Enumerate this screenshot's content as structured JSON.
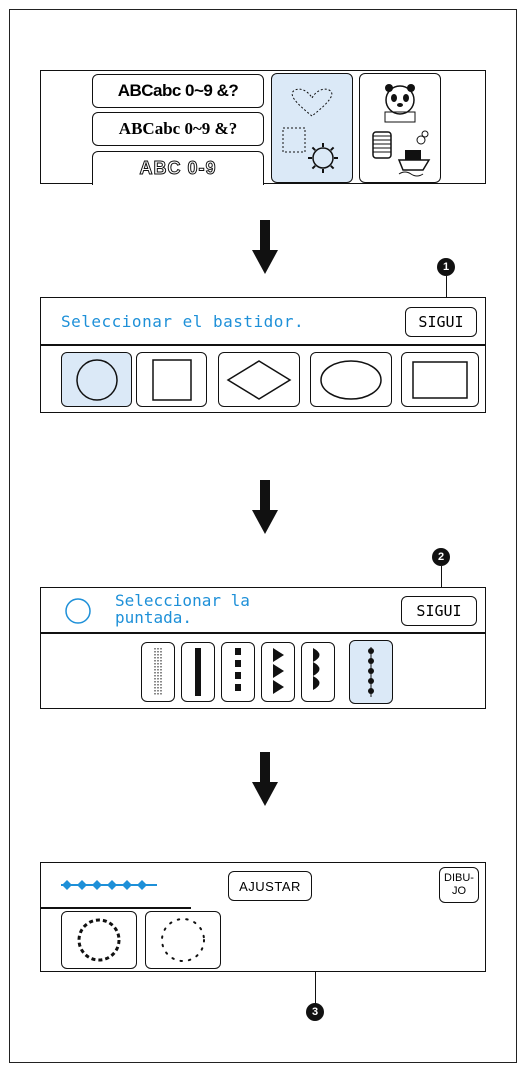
{
  "screen1": {
    "fonts": [
      "ABCabc 0~9 &?",
      "ABCabc 0~9 &?",
      "ABC 0-9"
    ]
  },
  "screen2": {
    "prompt": "Seleccionar el bastidor.",
    "next_button": "SIGUI",
    "frames": [
      "circle",
      "square",
      "diamond",
      "oval",
      "rectangle"
    ],
    "selected_frame": "circle",
    "callout": "1"
  },
  "screen3": {
    "prompt_line1": "Seleccionar la",
    "prompt_line2": "puntada.",
    "next_button": "SIGUI",
    "stitches": [
      "triple-line",
      "bar",
      "dash",
      "triangle",
      "scallop",
      "bead"
    ],
    "selected_stitch": "bead",
    "callout": "2"
  },
  "screen4": {
    "adjust_button": "AJUSTAR",
    "design_button_l1": "DIBU-",
    "design_button_l2": "JO",
    "callout": "3"
  },
  "colors": {
    "accent": "#1e90d8",
    "selected": "#dbe9f7"
  }
}
